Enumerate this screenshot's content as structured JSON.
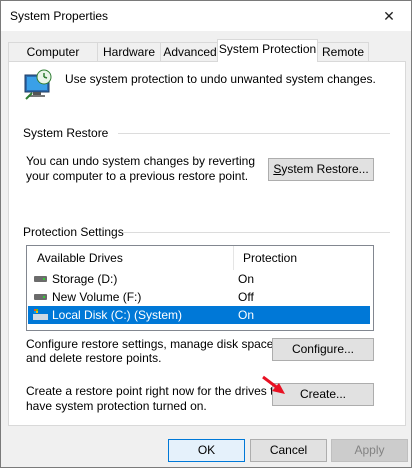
{
  "window": {
    "title": "System Properties",
    "close_glyph": "✕"
  },
  "tabs": [
    {
      "label": "Computer Name"
    },
    {
      "label": "Hardware"
    },
    {
      "label": "Advanced"
    },
    {
      "label": "System Protection",
      "active": true
    },
    {
      "label": "Remote"
    }
  ],
  "intro": {
    "text": "Use system protection to undo unwanted system changes.",
    "icon": "system-protection-icon"
  },
  "system_restore": {
    "header": "System Restore",
    "desc_line1": "You can undo system changes by reverting",
    "desc_line2": "your computer to a previous restore point.",
    "button_label": "System Restore...",
    "button_mnemonic": "S",
    "button_rest": "ystem Restore..."
  },
  "protection": {
    "header": "Protection Settings",
    "columns": {
      "drives": "Available Drives",
      "protection": "Protection"
    },
    "drives": [
      {
        "name": "Storage (D:)",
        "status": "On",
        "selected": false
      },
      {
        "name": "New Volume (F:)",
        "status": "Off",
        "selected": false
      },
      {
        "name": "Local Disk (C:) (System)",
        "status": "On",
        "selected": true
      }
    ],
    "configure_desc_line1": "Configure restore settings, manage disk space,",
    "configure_desc_line2": "and delete restore points.",
    "configure_mnemonic": "O",
    "configure_button": "Configure...",
    "create_desc_line1": "Create a restore point right now for the drives that",
    "create_desc_line2": "have system protection turned on.",
    "create_button": "Create..."
  },
  "footer": {
    "ok": "OK",
    "cancel": "Cancel",
    "apply": "Apply"
  },
  "colors": {
    "selection": "#0078d7",
    "arrow": "#e81123"
  }
}
